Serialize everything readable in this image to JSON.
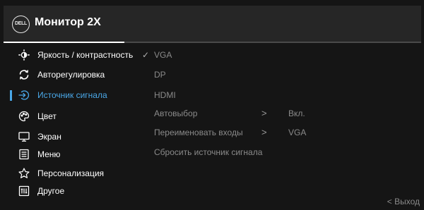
{
  "header": {
    "logo_text": "DELL",
    "title": "Монитор 2X",
    "progress": 0.29
  },
  "menu": {
    "items": [
      {
        "label": "Яркость / контрастность",
        "icon": "brightness-icon"
      },
      {
        "label": "Авторегулировка",
        "icon": "auto-adjust-icon"
      },
      {
        "label": "Источник сигнала",
        "icon": "input-source-icon",
        "selected": true
      },
      {
        "label": "Цвет",
        "icon": "color-palette-icon"
      },
      {
        "label": "Экран",
        "icon": "display-icon"
      },
      {
        "label": "Меню",
        "icon": "menu-icon"
      },
      {
        "label": "Персонализация",
        "icon": "star-icon"
      },
      {
        "label": "Другое",
        "icon": "others-icon"
      }
    ],
    "check_mark": "✓"
  },
  "submenu": {
    "options": [
      {
        "label": "VGA"
      },
      {
        "label": "DP"
      },
      {
        "label": "HDMI"
      },
      {
        "label": "Автовыбор",
        "arrow": ">",
        "value": "Вкл."
      },
      {
        "label": "Переименовать входы",
        "arrow": ">",
        "value": "VGA"
      },
      {
        "label": "Сбросить источник сигнала"
      }
    ]
  },
  "footer": {
    "exit_label": "< Выход"
  },
  "colors": {
    "background": "#151515",
    "header": "#262626",
    "accent": "#4aa8e8",
    "text": "#ffffff",
    "muted": "#8a8a8a"
  }
}
